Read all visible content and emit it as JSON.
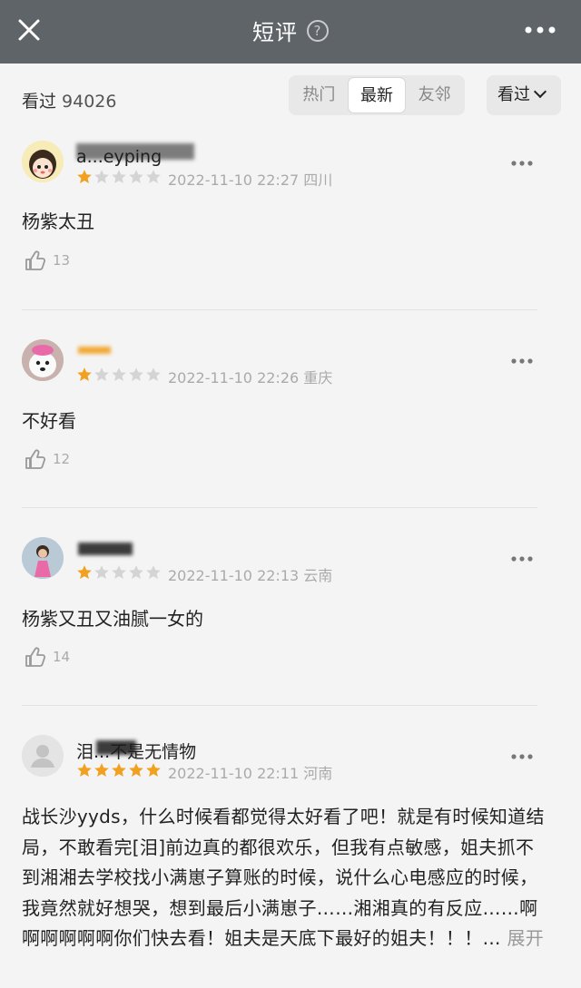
{
  "header": {
    "title": "短评",
    "help_icon": "?"
  },
  "filter": {
    "seen_label": "看过",
    "seen_count": "94026",
    "tabs": [
      "热门",
      "最新",
      "友邻"
    ],
    "active_tab": "最新",
    "dropdown_label": "看过"
  },
  "reviews": [
    {
      "username": "a...eyping",
      "rating": 1,
      "time": "2022-11-10 22:27",
      "location": "四川",
      "text": "杨紫太丑",
      "likes": "13"
    },
    {
      "username": "",
      "rating": 1,
      "time": "2022-11-10 22:26",
      "location": "重庆",
      "text": "不好看",
      "likes": "12"
    },
    {
      "username": "",
      "rating": 1,
      "time": "2022-11-10 22:13",
      "location": "云南",
      "text": "杨紫又丑又油腻一女的",
      "likes": "14"
    },
    {
      "username": "泪...不是无情物",
      "rating": 5,
      "time": "2022-11-10 22:11",
      "location": "河南",
      "text": "战长沙yyds，什么时候看都觉得太好看了吧！就是有时候知道结局，不敢看完[泪]前边真的都很欢乐，但我有点敏感，姐夫抓不到湘湘去学校找小满崽子算账的时候，说什么心电感应的时候，我竟然就好想哭，想到最后小满崽子……湘湘真的有反应……啊啊啊啊啊啊你们快去看！姐夫是天底下最好的姐夫！！！…",
      "expand": "展开",
      "likes": ""
    }
  ],
  "colors": {
    "header_bg": "#5f6468",
    "star_filled": "#f2a01f",
    "star_empty": "#d4d4d4",
    "page_bg": "#f4f4f4"
  }
}
